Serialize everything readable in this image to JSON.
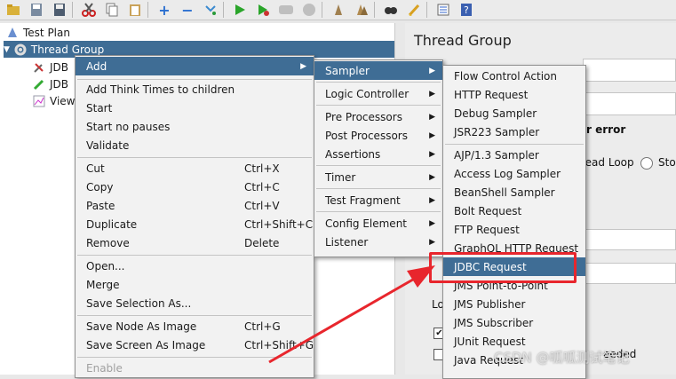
{
  "toolbar": {
    "icons": [
      "open-icon",
      "save-as-icon",
      "save-icon",
      "cut-icon",
      "copy-icon",
      "paste-icon",
      "expand-icon",
      "collapse-icon",
      "toggle-icon",
      "start-icon",
      "start-no-pause-icon",
      "stop-icon",
      "shutdown-icon",
      "clear-icon",
      "clear-all-icon",
      "search-icon",
      "reset-search-icon",
      "function-helper-icon",
      "help-icon"
    ]
  },
  "tree": {
    "test_plan": "Test Plan",
    "thread_group": "Thread Group",
    "child1": "JDB",
    "child2": "JDB",
    "child3": "View"
  },
  "right_panel": {
    "title": "Thread Group",
    "error_label": "r error",
    "thread_loop_label": "read Loop",
    "stop_label": "Sto",
    "lo_label": "Lo",
    "n_label": "n",
    "needed_label": "eeded"
  },
  "menu_main": {
    "add": "Add",
    "add_think_times": "Add Think Times to children",
    "start": "Start",
    "start_no_pauses": "Start no pauses",
    "validate": "Validate",
    "cut": "Cut",
    "cut_sc": "Ctrl+X",
    "copy": "Copy",
    "copy_sc": "Ctrl+C",
    "paste": "Paste",
    "paste_sc": "Ctrl+V",
    "duplicate": "Duplicate",
    "duplicate_sc": "Ctrl+Shift+C",
    "remove": "Remove",
    "remove_sc": "Delete",
    "open": "Open...",
    "merge": "Merge",
    "save_selection": "Save Selection As...",
    "save_node_image": "Save Node As Image",
    "save_node_image_sc": "Ctrl+G",
    "save_screen_image": "Save Screen As Image",
    "save_screen_image_sc": "Ctrl+Shift+G",
    "enable": "Enable"
  },
  "menu_add": {
    "sampler": "Sampler",
    "logic_controller": "Logic Controller",
    "pre_processors": "Pre Processors",
    "post_processors": "Post Processors",
    "assertions": "Assertions",
    "timer": "Timer",
    "test_fragment": "Test Fragment",
    "config_element": "Config Element",
    "listener": "Listener"
  },
  "menu_sampler": {
    "flow_control_action": "Flow Control Action",
    "http_request": "HTTP Request",
    "debug_sampler": "Debug Sampler",
    "jsr223_sampler": "JSR223 Sampler",
    "ajp_sampler": "AJP/1.3 Sampler",
    "access_log_sampler": "Access Log Sampler",
    "beanshell_sampler": "BeanShell Sampler",
    "bolt_request": "Bolt Request",
    "ftp_request": "FTP Request",
    "graphql_request": "GraphQL HTTP Request",
    "jdbc_request": "JDBC Request",
    "jms_point_to_point": "JMS Point-to-Point",
    "jms_publisher": "JMS Publisher",
    "jms_subscriber": "JMS Subscriber",
    "junit_request": "JUnit Request",
    "java_request": "Java Request"
  },
  "watermark": "CSDN @呱呱测试笔记",
  "colors": {
    "highlight": "#3f6d95",
    "annotation_red": "#e8262d"
  }
}
